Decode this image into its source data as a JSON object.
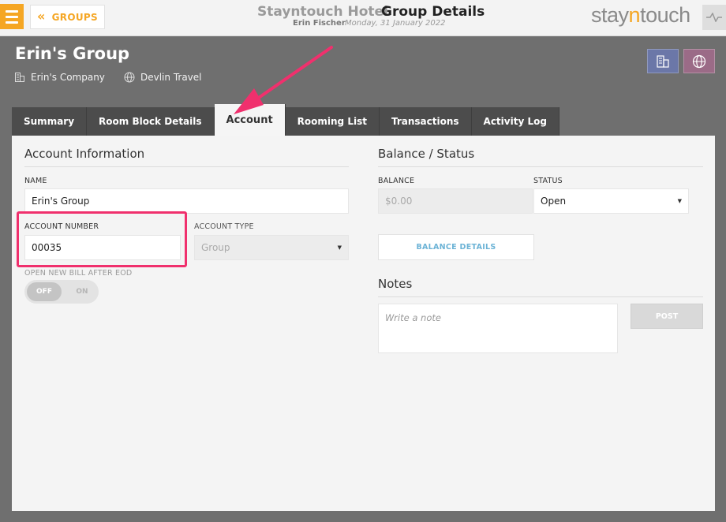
{
  "topbar": {
    "groups_label": "GROUPS",
    "hotel_name": "Stayntouch Hotel",
    "page_title": "Group Details",
    "user_name": "Erin Fischer",
    "business_date": "Monday, 31 January 2022",
    "logo": {
      "part1": "stay",
      "part2": "n",
      "part3": "touch"
    }
  },
  "group": {
    "name": "Erin's Group",
    "company": "Erin's Company",
    "travel_agent": "Devlin Travel"
  },
  "tabs": [
    {
      "label": "Summary"
    },
    {
      "label": "Room Block Details"
    },
    {
      "label": "Account",
      "active": true
    },
    {
      "label": "Rooming List"
    },
    {
      "label": "Transactions"
    },
    {
      "label": "Activity Log"
    }
  ],
  "account_info": {
    "title": "Account Information",
    "name_label": "NAME",
    "name_value": "Erin's Group",
    "account_number_label": "ACCOUNT NUMBER",
    "account_number_value": "00035",
    "account_type_label": "ACCOUNT TYPE",
    "account_type_value": "Group",
    "open_bill_label": "OPEN NEW BILL AFTER EOD",
    "toggle_off": "OFF",
    "toggle_on": "ON"
  },
  "balance_status": {
    "title": "Balance / Status",
    "balance_label": "BALANCE",
    "balance_value": "$0.00",
    "status_label": "STATUS",
    "status_value": "Open",
    "balance_details_label": "BALANCE DETAILS"
  },
  "notes": {
    "title": "Notes",
    "placeholder": "Write a note",
    "post_label": "POST"
  },
  "colors": {
    "accent": "#f5a623",
    "annotation": "#f0306d",
    "link": "#6cb3d6"
  }
}
